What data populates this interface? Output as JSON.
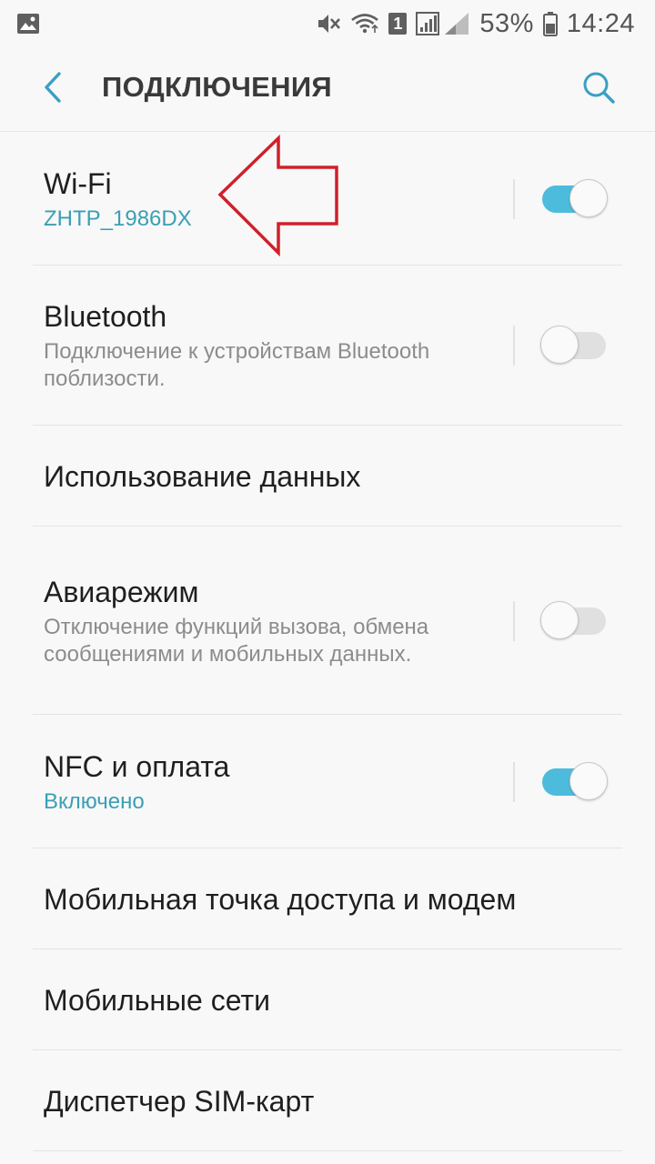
{
  "status_bar": {
    "battery": "53%",
    "time": "14:24",
    "sim_slot": "1",
    "icons": [
      "image-icon",
      "mute-icon",
      "wifi-icon",
      "sim-icon",
      "signal-icon",
      "battery-icon"
    ]
  },
  "app_bar": {
    "title": "ПОДКЛЮЧЕНИЯ",
    "back_icon": "chevron-left-icon",
    "search_icon": "search-icon"
  },
  "items": [
    {
      "title": "Wi-Fi",
      "subtitle": "ZHTP_1986DX",
      "subtitle_accent": true,
      "toggle": true,
      "toggle_on": true
    },
    {
      "title": "Bluetooth",
      "subtitle": "Подключение к устройствам Bluetooth поблизости.",
      "subtitle_accent": false,
      "toggle": true,
      "toggle_on": false
    },
    {
      "title": "Использование данных"
    },
    {
      "title": "Авиарежим",
      "subtitle": "Отключение функций вызова, обмена сообщениями и мобильных данных.",
      "subtitle_accent": false,
      "toggle": true,
      "toggle_on": false
    },
    {
      "title": "NFC и оплата",
      "subtitle": "Включено",
      "subtitle_accent": true,
      "toggle": true,
      "toggle_on": true
    },
    {
      "title": "Мобильная точка доступа и модем"
    },
    {
      "title": "Мобильные сети"
    },
    {
      "title": "Диспетчер SIM-карт"
    }
  ],
  "colors": {
    "accent": "#4dbcdc",
    "subtitle_accent": "#3a9fb3",
    "annotation_arrow": "#d0202a"
  }
}
